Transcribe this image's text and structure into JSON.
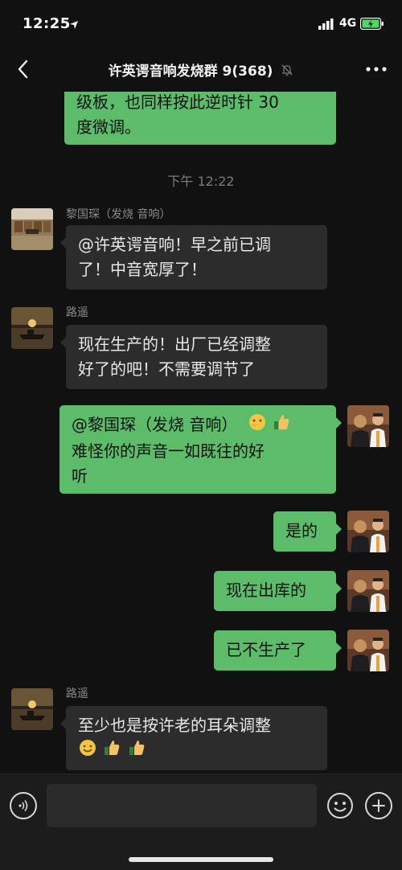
{
  "status": {
    "time": "12:25",
    "network": "4G"
  },
  "nav": {
    "title": "许英谔音响发烧群 9(368)"
  },
  "messages": {
    "m0": {
      "line1": "级板，也同样按此逆时针 30",
      "line2": "度微调。"
    },
    "ts": "下午 12:22",
    "m1": {
      "sender": "黎国琛（发烧 音响）",
      "line1": "@许英谔音响！早之前已调",
      "line2": "了！中音宽厚了！"
    },
    "m2": {
      "sender": "路遥",
      "line1": "现在生产的！出厂已经调整",
      "line2": "好了的吧！不需要调节了"
    },
    "m3": {
      "line1": "@黎国琛（发烧 音响）",
      "line2": "难怪你的声音一如既往的好",
      "line3": "听"
    },
    "m4": {
      "text": "是的"
    },
    "m5": {
      "text": "现在出库的"
    },
    "m6": {
      "text": "已不生产了"
    },
    "m7": {
      "sender": "路遥",
      "line1": "至少也是按许老的耳朵调整"
    }
  },
  "icons": {
    "back": "chevron-left-icon",
    "more": "more-dots-icon",
    "mute": "mute-bell-icon",
    "voice": "voice-icon",
    "emoji": "smiley-icon",
    "plus": "plus-icon"
  },
  "colors": {
    "background": "#111111",
    "bubble_self": "#5dbc6a",
    "bubble_other": "#2c2c2c"
  }
}
